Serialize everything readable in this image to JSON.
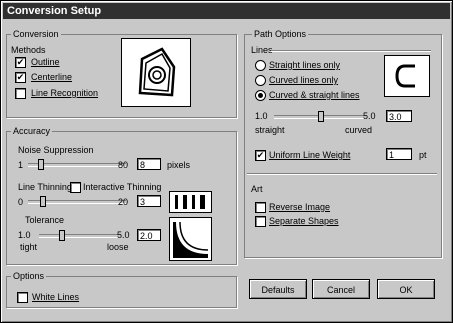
{
  "window": {
    "title": "Conversion Setup"
  },
  "conversion": {
    "group_title": "Conversion",
    "methods_label": "Methods",
    "methods": [
      {
        "label": "Outline",
        "checked": true
      },
      {
        "label": "Centerline",
        "checked": true
      },
      {
        "label": "Line Recognition",
        "checked": false
      }
    ]
  },
  "accuracy": {
    "group_title": "Accuracy",
    "noise": {
      "label": "Noise Suppression",
      "min": "1",
      "max": "80",
      "value": "8",
      "unit": "pixels"
    },
    "thinning": {
      "label": "Line Thinning",
      "min": "0",
      "max": "20",
      "value": "3",
      "interactive_label": "Interactive Thinning",
      "interactive_checked": false
    },
    "tolerance": {
      "label": "Tolerance",
      "min": "1.0",
      "max": "5.0",
      "value": "2.0",
      "min_caption": "tight",
      "max_caption": "loose"
    }
  },
  "options": {
    "group_title": "Options",
    "white_lines_label": "White Lines",
    "white_lines_checked": false
  },
  "path_options": {
    "group_title": "Path Options",
    "lines_label": "Lines",
    "line_types": [
      {
        "label": "Straight lines only",
        "selected": false
      },
      {
        "label": "Curved lines only",
        "selected": false
      },
      {
        "label": "Curved & straight lines",
        "selected": true
      }
    ],
    "curve_min": "1.0",
    "curve_max": "5.0",
    "curve_value": "3.0",
    "curve_min_caption": "straight",
    "curve_max_caption": "curved",
    "uniform_label": "Uniform Line Weight",
    "uniform_checked": true,
    "uniform_value": "1",
    "uniform_unit": "pt"
  },
  "art": {
    "group_title": "Art",
    "reverse_label": "Reverse Image",
    "reverse_checked": false,
    "separate_label": "Separate Shapes",
    "separate_checked": false
  },
  "buttons": {
    "defaults": "Defaults",
    "cancel": "Cancel",
    "ok": "OK"
  }
}
